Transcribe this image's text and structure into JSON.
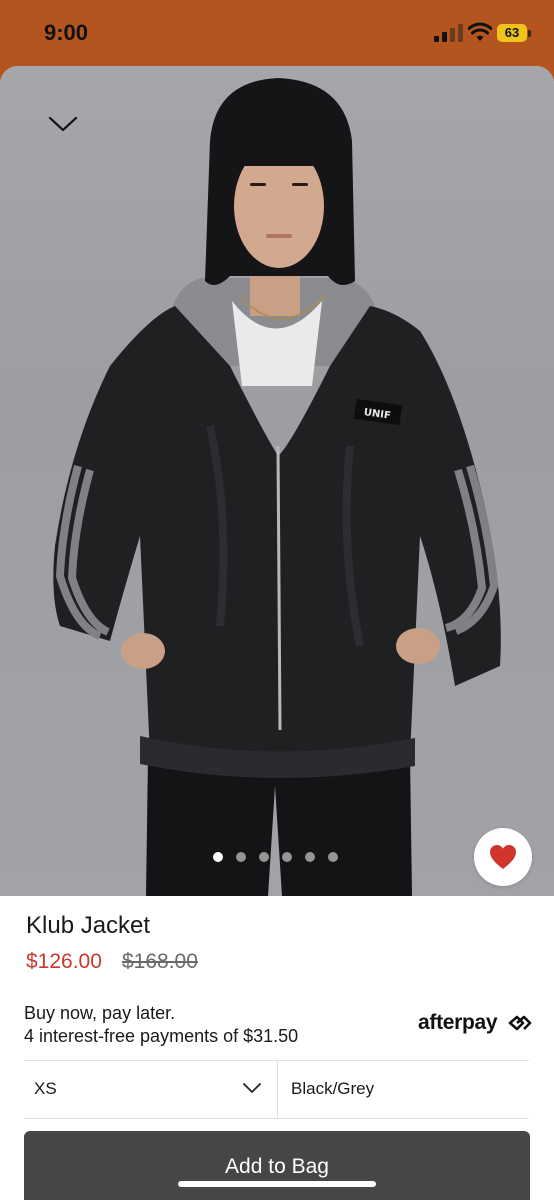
{
  "status_bar": {
    "time": "9:00",
    "battery": "63"
  },
  "product": {
    "name": "Klub Jacket",
    "sale_price": "$126.00",
    "original_price": "$168.00"
  },
  "gallery": {
    "image_count": 6,
    "active_index": 0,
    "patch_text": "UNIF"
  },
  "payment": {
    "title": "Buy now, pay later.",
    "subtitle": "4 interest-free payments of $31.50",
    "provider": "afterpay"
  },
  "options": {
    "size": "XS",
    "color": "Black/Grey"
  },
  "actions": {
    "add_to_bag": "Add to Bag"
  },
  "colors": {
    "status_bar": "#b4551f",
    "sale_price": "#c53a2e",
    "button": "#464646",
    "favorite": "#d0342c"
  },
  "icons": [
    "close-chevron-icon",
    "heart-icon",
    "chevron-down-icon",
    "afterpay-logo-icon",
    "signal-icon",
    "wifi-icon",
    "battery-icon"
  ]
}
